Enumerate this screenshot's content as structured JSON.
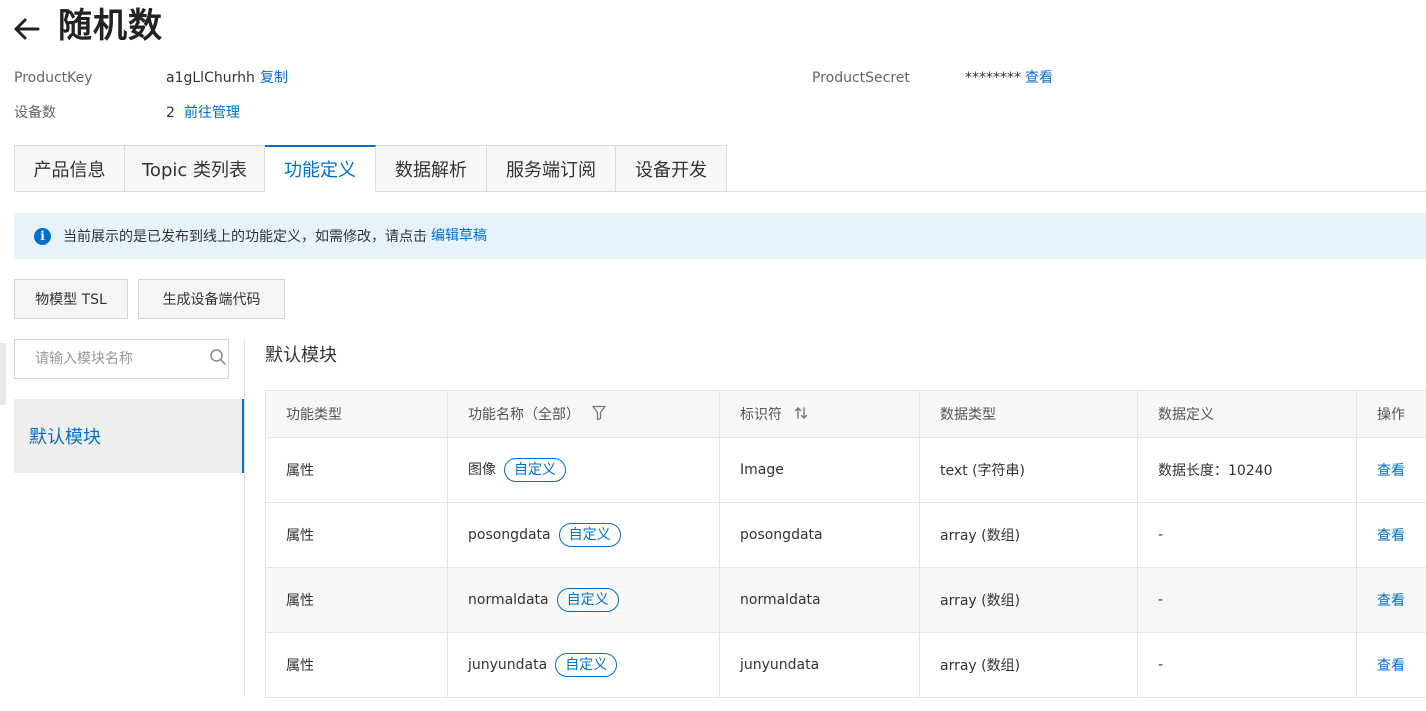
{
  "header": {
    "title": "随机数",
    "back_icon": "arrow-left-icon"
  },
  "meta": {
    "product_key_label": "ProductKey",
    "product_key_value": "a1gLlChurhh",
    "copy_link": "复制",
    "device_count_label": "设备数",
    "device_count_value": "2",
    "manage_link": "前往管理",
    "product_secret_label": "ProductSecret",
    "product_secret_value": "********",
    "view_link": "查看"
  },
  "tabs": [
    {
      "label": "产品信息",
      "active": false
    },
    {
      "label": "Topic 类列表",
      "active": false
    },
    {
      "label": "功能定义",
      "active": true
    },
    {
      "label": "数据解析",
      "active": false
    },
    {
      "label": "服务端订阅",
      "active": false
    },
    {
      "label": "设备开发",
      "active": false
    }
  ],
  "notice": {
    "icon": "info-icon",
    "text": "当前展示的是已发布到线上的功能定义，如需修改，请点击",
    "link": "编辑草稿"
  },
  "toolbar": {
    "tsl_button": "物模型 TSL",
    "codegen_button": "生成设备端代码"
  },
  "sidebar": {
    "search_placeholder": "请输入模块名称",
    "search_icon": "search-icon",
    "modules": [
      {
        "label": "默认模块",
        "active": true
      }
    ]
  },
  "main": {
    "section_title": "默认模块",
    "columns": [
      "功能类型",
      "功能名称（全部）",
      "标识符",
      "数据类型",
      "数据定义",
      "操作"
    ],
    "rows": [
      {
        "type": "属性",
        "name": "图像",
        "tag": "自定义",
        "identifier": "Image",
        "data_type": "text (字符串)",
        "definition": "数据长度：10240",
        "action": "查看"
      },
      {
        "type": "属性",
        "name": "posongdata",
        "tag": "自定义",
        "identifier": "posongdata",
        "data_type": "array (数组)",
        "definition": "-",
        "action": "查看"
      },
      {
        "type": "属性",
        "name": "normaldata",
        "tag": "自定义",
        "identifier": "normaldata",
        "data_type": "array (数组)",
        "definition": "-",
        "action": "查看"
      },
      {
        "type": "属性",
        "name": "junyundata",
        "tag": "自定义",
        "identifier": "junyundata",
        "data_type": "array (数组)",
        "definition": "-",
        "action": "查看"
      }
    ]
  },
  "colors": {
    "accent": "#0070cc",
    "notice_bg": "#e6f3fd",
    "header_bg": "#f7f7f7",
    "border": "#e5e5e5"
  }
}
